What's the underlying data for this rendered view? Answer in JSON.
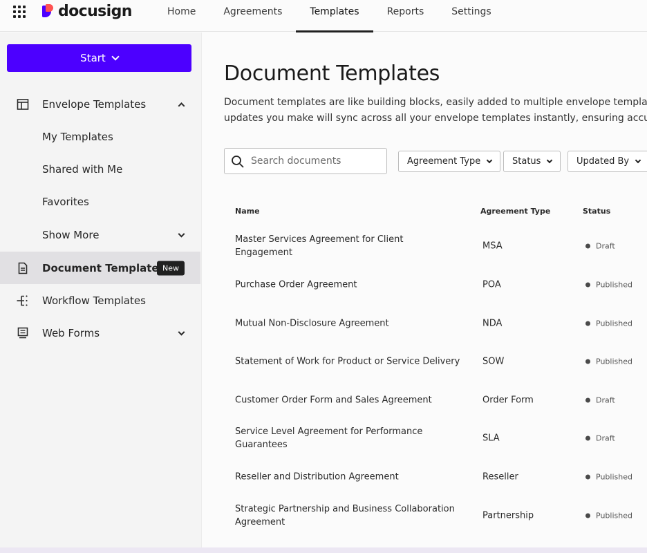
{
  "brand": {
    "name": "docusign"
  },
  "nav": {
    "tabs": [
      {
        "label": "Home"
      },
      {
        "label": "Agreements"
      },
      {
        "label": "Templates",
        "active": true
      },
      {
        "label": "Reports"
      },
      {
        "label": "Settings"
      }
    ]
  },
  "sidebar": {
    "start_label": "Start",
    "items": [
      {
        "label": "Envelope Templates",
        "icon": "layout-icon",
        "expanded": true
      },
      {
        "label": "My Templates"
      },
      {
        "label": "Shared with Me"
      },
      {
        "label": "Favorites"
      },
      {
        "label": "Show More"
      },
      {
        "label": "Document Templates",
        "icon": "document-icon",
        "selected": true,
        "badge": "New"
      },
      {
        "label": "Workflow Templates",
        "icon": "workflow-icon"
      },
      {
        "label": "Web Forms",
        "icon": "form-icon"
      }
    ]
  },
  "main": {
    "title": "Document Templates",
    "description_line1": "Document templates are like building blocks, easily added to multiple envelope templates",
    "description_line2": "updates you make will sync across all your envelope templates instantly, ensuring accura",
    "search": {
      "placeholder": "Search documents"
    },
    "filters": [
      {
        "label": "Agreement Type"
      },
      {
        "label": "Status"
      },
      {
        "label": "Updated By"
      }
    ],
    "table": {
      "columns": [
        "Name",
        "Agreement Type",
        "Status"
      ],
      "rows": [
        {
          "name": "Master Services Agreement for Client Engagement",
          "type": "MSA",
          "status": "Draft"
        },
        {
          "name": "Purchase Order Agreement",
          "type": "POA",
          "status": "Published"
        },
        {
          "name": "Mutual Non-Disclosure Agreement",
          "type": "NDA",
          "status": "Published"
        },
        {
          "name": "Statement of Work for Product or Service Delivery",
          "type": "SOW",
          "status": "Published"
        },
        {
          "name": "Customer Order Form and Sales Agreement",
          "type": "Order Form",
          "status": "Draft"
        },
        {
          "name": "Service Level Agreement for Performance Guarantees",
          "type": "SLA",
          "status": "Draft"
        },
        {
          "name": "Reseller and Distribution Agreement",
          "type": "Reseller",
          "status": "Published"
        },
        {
          "name": "Strategic Partnership and Business Collaboration Agreement",
          "type": "Partnership",
          "status": "Published"
        }
      ]
    }
  },
  "colors": {
    "accent": "#4c00ff",
    "logo_red": "#ff5252",
    "selected_bg": "#e1e0e3"
  }
}
